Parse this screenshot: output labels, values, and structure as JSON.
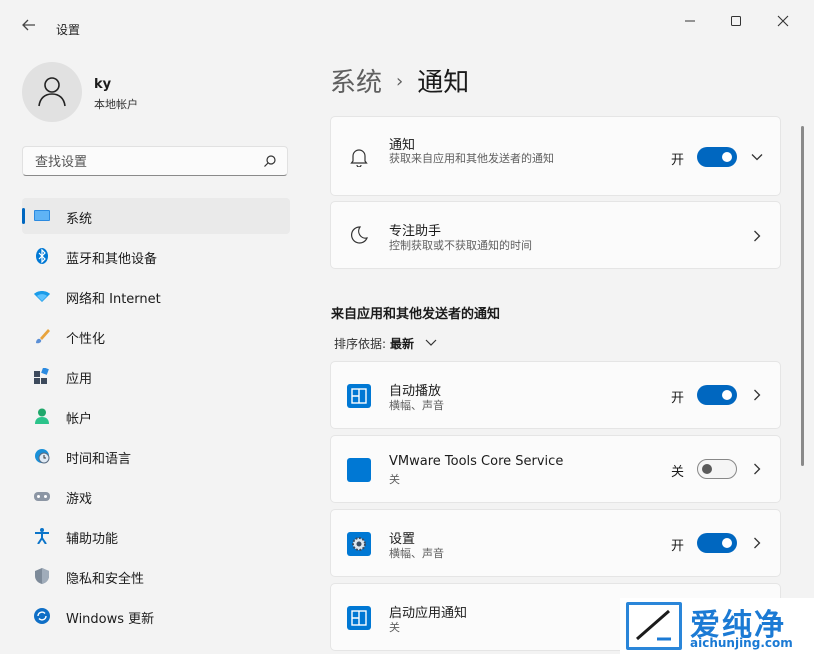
{
  "window": {
    "title": "设置",
    "back_icon": "arrow-left-icon",
    "min_icon": "minimize-icon",
    "max_icon": "maximize-icon",
    "close_icon": "close-icon"
  },
  "profile": {
    "name": "ky",
    "type": "本地帐户"
  },
  "search": {
    "placeholder": "查找设置"
  },
  "nav": {
    "items": [
      {
        "label": "系统",
        "icon": "monitor-icon",
        "active": true
      },
      {
        "label": "蓝牙和其他设备",
        "icon": "bluetooth-icon"
      },
      {
        "label": "网络和 Internet",
        "icon": "wifi-icon"
      },
      {
        "label": "个性化",
        "icon": "brush-icon"
      },
      {
        "label": "应用",
        "icon": "apps-icon"
      },
      {
        "label": "帐户",
        "icon": "person-icon"
      },
      {
        "label": "时间和语言",
        "icon": "globe-clock-icon"
      },
      {
        "label": "游戏",
        "icon": "gamepad-icon"
      },
      {
        "label": "辅助功能",
        "icon": "accessibility-icon"
      },
      {
        "label": "隐私和安全性",
        "icon": "shield-icon"
      },
      {
        "label": "Windows 更新",
        "icon": "update-icon"
      }
    ]
  },
  "breadcrumb": {
    "parent": "系统",
    "separator": "›",
    "current": "通知"
  },
  "notifications_card": {
    "title": "通知",
    "desc": "获取来自应用和其他发送者的通知",
    "state": "开",
    "icon": "bell-icon"
  },
  "focus_card": {
    "title": "专注助手",
    "desc": "控制获取或不获取通知的时间",
    "icon": "moon-icon"
  },
  "section": {
    "title": "来自应用和其他发送者的通知",
    "sort_label": "排序依据:",
    "sort_value": "最新"
  },
  "apps": [
    {
      "name": "自动播放",
      "desc": "横幅、声音",
      "state": "开",
      "on": true
    },
    {
      "name": "VMware Tools Core Service",
      "desc": "关",
      "state": "关",
      "on": false
    },
    {
      "name": "设置",
      "desc": "横幅、声音",
      "state": "开",
      "on": true
    },
    {
      "name": "启动应用通知",
      "desc": "关"
    }
  ],
  "watermark": {
    "text": "爱纯净",
    "url": "aichunjing.com"
  },
  "colors": {
    "accent": "#0067c0",
    "background": "#f3f3f3",
    "card": "#fbfbfb"
  }
}
